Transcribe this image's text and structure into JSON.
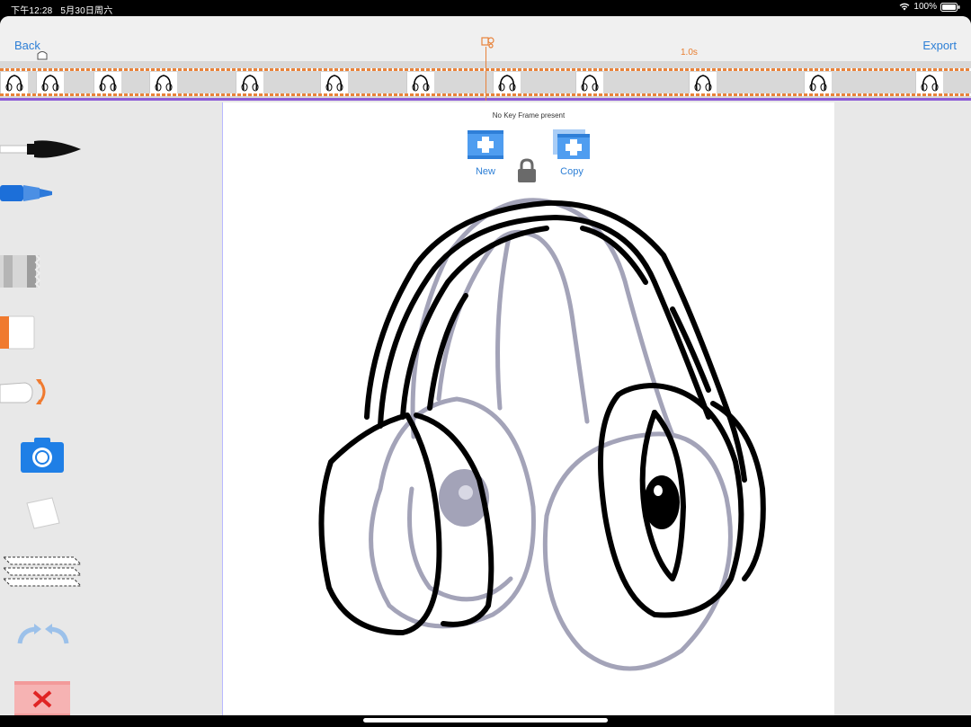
{
  "status_bar": {
    "time": "下午12:28",
    "date": "5月30日周六",
    "battery": "100%"
  },
  "header": {
    "back_label": "Back",
    "export_label": "Export"
  },
  "timeline": {
    "time_marker": "1.0s"
  },
  "canvas": {
    "keyframe_status": "No Key Frame present",
    "new_label": "New",
    "copy_label": "Copy"
  },
  "tools": [
    {
      "name": "pen-tool"
    },
    {
      "name": "marker-tool"
    },
    {
      "name": "texture-brush-tool"
    },
    {
      "name": "eraser-tool"
    },
    {
      "name": "transform-hand-tool"
    },
    {
      "name": "camera-tool"
    },
    {
      "name": "paper-tool"
    },
    {
      "name": "layers-tool"
    },
    {
      "name": "undo-redo-tool"
    },
    {
      "name": "delete-frame-tool"
    }
  ],
  "colors": {
    "accent": "#2d7fd6",
    "timeline_orange": "#e8823a",
    "onion_skin": "#a3a3b8",
    "stroke": "#000000"
  }
}
